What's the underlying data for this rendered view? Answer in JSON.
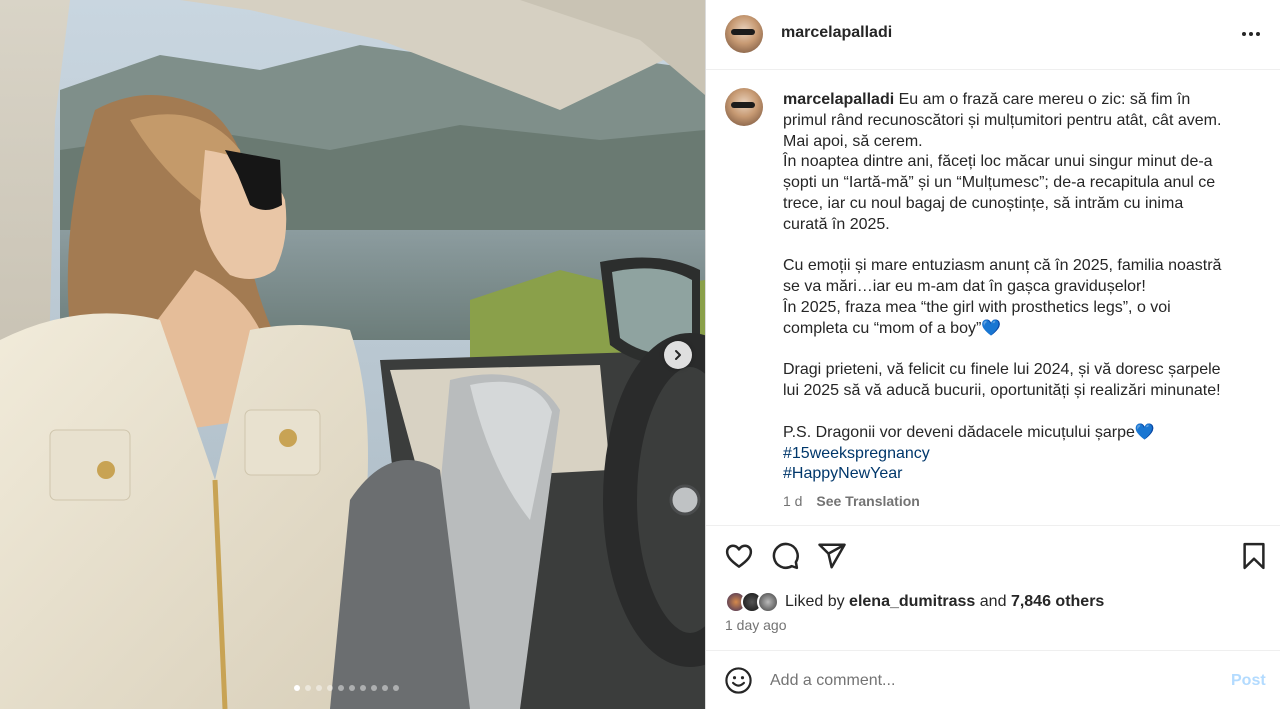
{
  "post": {
    "username": "marcelapalladi",
    "caption_lines": [
      "Eu am o frază care mereu o zic: să fim în",
      "primul rând recunoscători și mulțumitori pentru atât, cât avem.",
      "Mai apoi, să cerem.",
      "În noaptea dintre ani, făceți loc măcar unui singur minut de-a",
      "șopti un “Iartă-mă” și un “Mulțumesc”; de-a recapitula anul ce",
      "trece, iar cu noul bagaj de cunoștințe, să intrăm cu inima",
      "curată în 2025.",
      "",
      "Cu emoții și mare entuziasm anunț că în 2025, familia noastră",
      "se va mări…iar eu m-am dat în gașca gravidușelor!",
      "În 2025, fraza mea “the girl with prosthetics legs”, o voi",
      "completa cu “mom of a boy”💙",
      "",
      "Dragi prieteni, vă felicit cu finele lui 2024, și vă doresc șarpele",
      "lui 2025 să vă aducă bucurii, oportunități și realizări minunate!",
      "",
      "P.S. Dragonii vor deveni dădacele micuțului șarpe💙"
    ],
    "hashtags": [
      "#15weekspregnancy",
      "#HappyNewYear"
    ],
    "age": "1 d",
    "see_translation": "See Translation",
    "likes": {
      "prefix": "Liked by",
      "user": "elena_dumitrass",
      "middle": "and",
      "others": "7,846 others"
    },
    "date": "1 day ago",
    "comment_placeholder": "Add a comment...",
    "post_button": "Post"
  },
  "carousel": {
    "slide_count": 10,
    "active_index": 0
  },
  "icons": {
    "more": "more-options-icon",
    "next": "chevron-right-icon",
    "like": "heart-icon",
    "comment": "comment-icon",
    "share": "share-icon",
    "save": "bookmark-icon",
    "emoji": "emoji-icon"
  },
  "colors": {
    "hashtag": "#00376b",
    "muted": "#737373",
    "post_disabled": "#b3dbff"
  }
}
